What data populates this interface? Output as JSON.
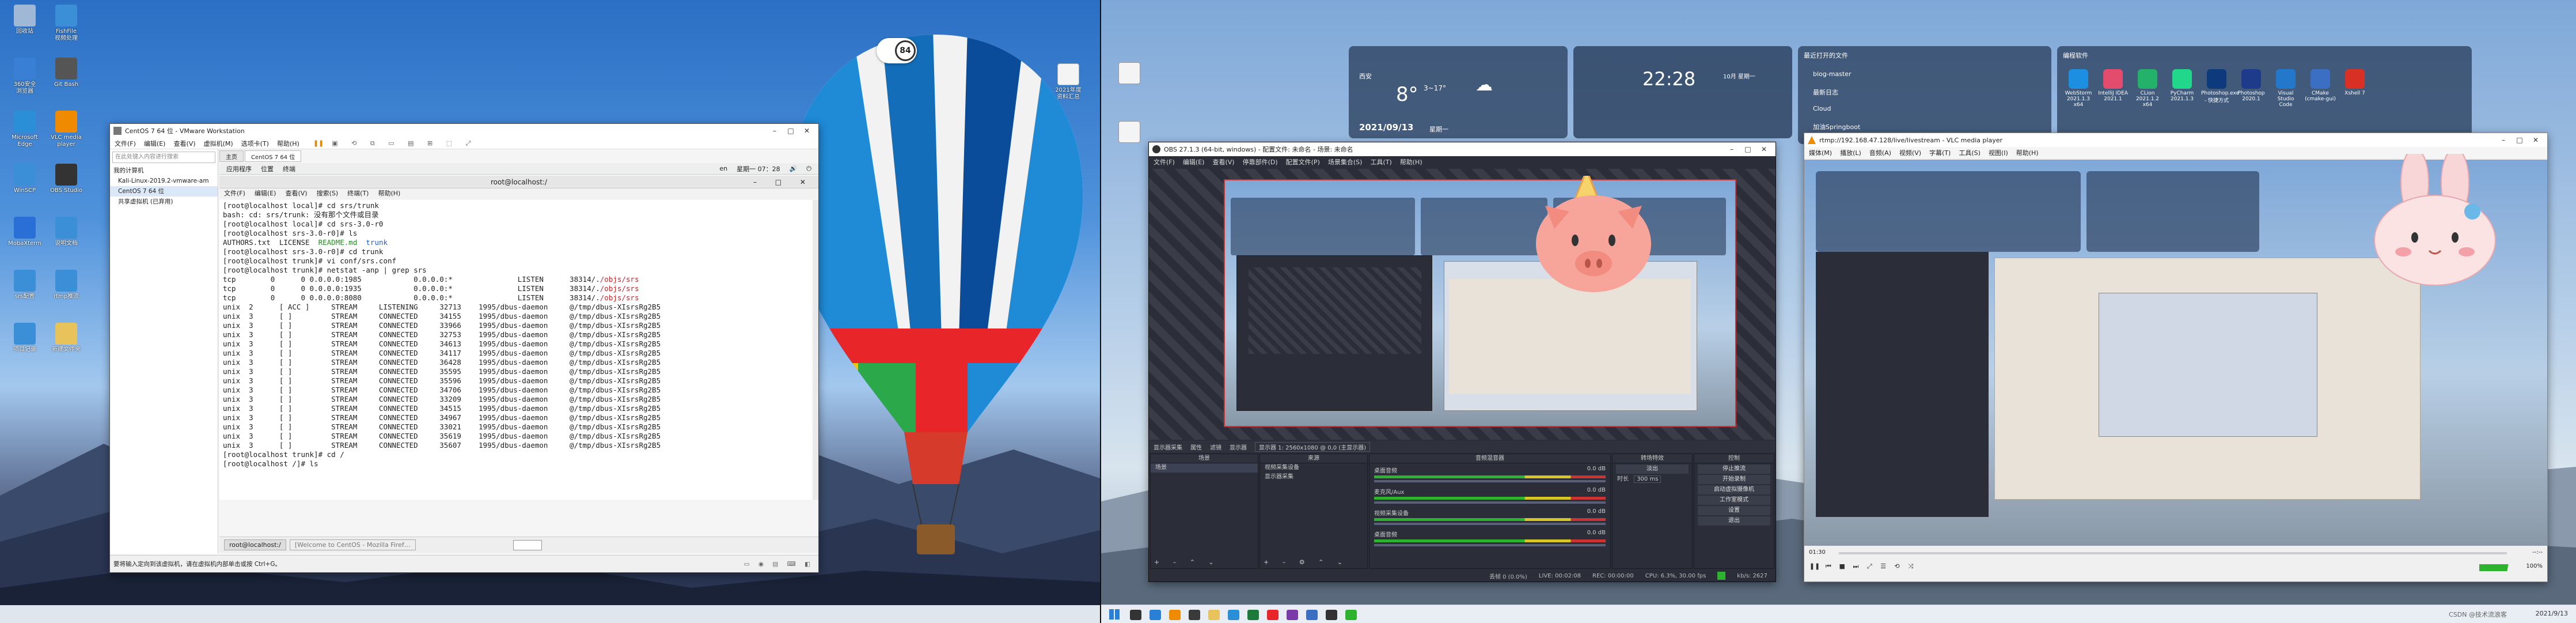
{
  "left_desktop": {
    "icons": [
      {
        "label": "回收站",
        "color": "#9fb8d6"
      },
      {
        "label": "FishFile\n视频处理",
        "color": "#3a8fd6"
      },
      {
        "label": "360安全\n浏览器",
        "color": "#3a7fd6"
      },
      {
        "label": "Git Bash",
        "color": "#555"
      },
      {
        "label": "Microsoft\nEdge",
        "color": "#2a8fd6"
      },
      {
        "label": "VLC media\nplayer",
        "color": "#f08a00"
      },
      {
        "label": "WinSCP",
        "color": "#3a8fd6"
      },
      {
        "label": "OBS Studio",
        "color": "#333"
      },
      {
        "label": "MobaXterm",
        "color": "#2a6fd6"
      },
      {
        "label": "说明文档",
        "color": "#3a8fd6"
      },
      {
        "label": "srs配置",
        "color": "#3a8fd6"
      },
      {
        "label": "rtmp推流",
        "color": "#3a8fd6"
      },
      {
        "label": "项目记录",
        "color": "#3a8fd6"
      },
      {
        "label": "新建文件夹",
        "color": "#e8c25a"
      }
    ],
    "right_icon": {
      "label": "2021年度\n资料汇总",
      "color": "#eee"
    },
    "badge": "84"
  },
  "vmware": {
    "title": "CentOS 7 64 位 - VMware Workstation",
    "menu": [
      "文件(F)",
      "编辑(E)",
      "查看(V)",
      "虚拟机(M)",
      "选项卡(T)",
      "帮助(H)"
    ],
    "library_search": "在此处键入内容进行搜索",
    "library_items": [
      "我的计算机",
      "Kali-Linux-2019.2-vmware-am",
      "CentOS 7 64 位",
      "共享虚拟机 (已弃用)"
    ],
    "tabs": [
      "主页",
      "CentOS 7 64 位"
    ],
    "gnome_menu": [
      "应用程序",
      "位置",
      "终端"
    ],
    "gnome_right": "en",
    "clock": "星期一 07：28",
    "term_title": "root@localhost:/",
    "term_menu": [
      "文件(F)",
      "编辑(E)",
      "查看(V)",
      "搜索(S)",
      "终端(T)",
      "帮助(H)"
    ],
    "term_lines": [
      "[root@localhost local]# cd srs/trunk",
      "bash: cd: srs/trunk: 没有那个文件或目录",
      "[root@localhost local]# cd srs-3.0-r0",
      "[root@localhost srs-3.0-r0]# ls",
      "AUTHORS.txt  LICENSE  README.md  trunk",
      "[root@localhost srs-3.0-r0]# cd trunk",
      "[root@localhost trunk]# vi conf/srs.conf",
      "[root@localhost trunk]# netstat -anp | grep srs",
      "tcp        0      0 0.0.0.0:1985            0.0.0.0:*               LISTEN      38314/./objs/srs",
      "tcp        0      0 0.0.0.0:1935            0.0.0.0:*               LISTEN      38314/./objs/srs",
      "tcp        0      0 0.0.0.0:8080            0.0.0.0:*               LISTEN      38314/./objs/srs",
      "unix  2      [ ACC ]     STREAM     LISTENING     32713    1995/dbus-daemon     @/tmp/dbus-XIsrsRg2B5",
      "unix  3      [ ]         STREAM     CONNECTED     34155    1995/dbus-daemon     @/tmp/dbus-XIsrsRg2B5",
      "unix  3      [ ]         STREAM     CONNECTED     33966    1995/dbus-daemon     @/tmp/dbus-XIsrsRg2B5",
      "unix  3      [ ]         STREAM     CONNECTED     32753    1995/dbus-daemon     @/tmp/dbus-XIsrsRg2B5",
      "unix  3      [ ]         STREAM     CONNECTED     34613    1995/dbus-daemon     @/tmp/dbus-XIsrsRg2B5",
      "unix  3      [ ]         STREAM     CONNECTED     34117    1995/dbus-daemon     @/tmp/dbus-XIsrsRg2B5",
      "unix  3      [ ]         STREAM     CONNECTED     36428    1995/dbus-daemon     @/tmp/dbus-XIsrsRg2B5",
      "unix  3      [ ]         STREAM     CONNECTED     35595    1995/dbus-daemon     @/tmp/dbus-XIsrsRg2B5",
      "unix  3      [ ]         STREAM     CONNECTED     35596    1995/dbus-daemon     @/tmp/dbus-XIsrsRg2B5",
      "unix  3      [ ]         STREAM     CONNECTED     34706    1995/dbus-daemon     @/tmp/dbus-XIsrsRg2B5",
      "unix  3      [ ]         STREAM     CONNECTED     33209    1995/dbus-daemon     @/tmp/dbus-XIsrsRg2B5",
      "unix  3      [ ]         STREAM     CONNECTED     34515    1995/dbus-daemon     @/tmp/dbus-XIsrsRg2B5",
      "unix  3      [ ]         STREAM     CONNECTED     34967    1995/dbus-daemon     @/tmp/dbus-XIsrsRg2B5",
      "unix  3      [ ]         STREAM     CONNECTED     33021    1995/dbus-daemon     @/tmp/dbus-XIsrsRg2B5",
      "unix  3      [ ]         STREAM     CONNECTED     35619    1995/dbus-daemon     @/tmp/dbus-XIsrsRg2B5",
      "unix  3      [ ]         STREAM     CONNECTED     35607    1995/dbus-daemon     @/tmp/dbus-XIsrsRg2B5",
      "[root@localhost trunk]# cd /",
      "[root@localhost /]# ls"
    ],
    "host_tabs": [
      "root@localhost:/",
      "[Welcome to CentOS - Mozilla Firef…"
    ],
    "status": "要将输入定向到该虚拟机，请在虚拟机内部单击或按 Ctrl+G。"
  },
  "dashboard": {
    "city": "西安",
    "temp": "8°",
    "temp_range": "3~17°",
    "date": "2021/09/13",
    "weekday": "星期一",
    "clock": "22:28",
    "clock_sub": "10月 星期一",
    "notes_title": "最近打开的文件",
    "notes": [
      "blog-master",
      "最新日志",
      "Cloud",
      "加油Springboot"
    ],
    "apps_title": "编程软件",
    "apps": [
      {
        "name": "WebStorm 2021.1.3 x64",
        "color": "#1d8fe0"
      },
      {
        "name": "IntelliJ IDEA 2021.1",
        "color": "#e34c6c"
      },
      {
        "name": "CLion 2021.1.2 x64",
        "color": "#24b26a"
      },
      {
        "name": "PyCharm 2021.1.3",
        "color": "#21d789"
      },
      {
        "name": "Photoshop.exe - 快捷方式",
        "color": "#0c3a7d"
      },
      {
        "name": "Photoshop 2020.1",
        "color": "#1e3a8a"
      },
      {
        "name": "Visual Studio Code",
        "color": "#2478cc"
      },
      {
        "name": "CMake (cmake-gui)",
        "color": "#3a6fc3"
      },
      {
        "name": "Xshell 7",
        "color": "#d93025"
      }
    ],
    "weather_temp": "8°",
    "weather_label": "雨"
  },
  "obs": {
    "title": "OBS 27.1.3 (64-bit, windows) - 配置文件: 未命名 - 场景: 未命名",
    "menu": [
      "文件(F)",
      "编辑(E)",
      "查看(V)",
      "停靠部件(D)",
      "配置文件(P)",
      "场景集合(S)",
      "工具(T)",
      "帮助(H)"
    ],
    "preview_bar": [
      "显示器采集",
      "属性",
      "滤镜",
      "显示器",
      "显示器 1: 2560x1080 @ 0,0 (主显示器)"
    ],
    "panels": {
      "scenes": "场景",
      "sources": "来源",
      "mixer": "音频混音器",
      "transitions": "转场特效",
      "controls": "控制"
    },
    "scenes": [
      "场景"
    ],
    "sources": [
      "视频采集设备",
      "显示器采集"
    ],
    "mixer": [
      {
        "name": "桌面音频",
        "db": "0.0 dB"
      },
      {
        "name": "麦克风/Aux",
        "db": "0.0 dB"
      },
      {
        "name": "视频采集设备",
        "db": "0.0 dB"
      },
      {
        "name": "桌面音频",
        "db": "0.0 dB"
      }
    ],
    "transition_name": "淡出",
    "duration_label": "时长",
    "duration": "300 ms",
    "controls": [
      "停止推流",
      "开始录制",
      "启动虚拟摄像机",
      "工作室模式",
      "设置",
      "退出"
    ],
    "status": {
      "drop": "丢帧 0 (0.0%)",
      "live": "LIVE: 00:02:08",
      "rec": "REC: 00:00:00",
      "cpu": "CPU: 6.3%, 30.00 fps",
      "kbps": "kb/s: 2627"
    }
  },
  "vlc": {
    "title": "rtmp://192.168.47.128/live/livestream - VLC media player",
    "menu": [
      "媒体(M)",
      "播放(L)",
      "音频(A)",
      "视频(V)",
      "字幕(T)",
      "工具(S)",
      "视图(I)",
      "帮助(H)"
    ],
    "time_left": "01:30",
    "time_right": "--:--",
    "volume": "100%"
  },
  "taskbar": {
    "right_label": "CSDN @技术流浪客",
    "date": "2021/9/13"
  }
}
